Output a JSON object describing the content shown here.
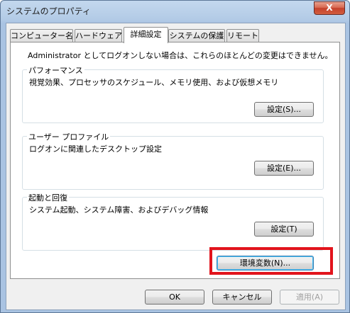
{
  "window": {
    "title": "システムのプロパティ",
    "close_label": "X"
  },
  "tabs": [
    {
      "label": "コンピューター名"
    },
    {
      "label": "ハードウェア"
    },
    {
      "label": "詳細設定"
    },
    {
      "label": "システムの保護"
    },
    {
      "label": "リモート"
    }
  ],
  "active_tab": "詳細設定",
  "panel": {
    "note": "Administrator としてログオンしない場合は、これらのほとんどの変更はできません。",
    "performance": {
      "title": "パフォーマンス",
      "description": "視覚効果、プロセッサのスケジュール、メモリ使用、および仮想メモリ",
      "button": "設定(S)..."
    },
    "user_profile": {
      "title": "ユーザー プロファイル",
      "description": "ログオンに関連したデスクトップ設定",
      "button": "設定(E)..."
    },
    "startup": {
      "title": "起動と回復",
      "description": "システム起動、システム障害、およびデバッグ情報",
      "button": "設定(T)"
    },
    "env_button": "環境変数(N)..."
  },
  "footer": {
    "ok": "OK",
    "cancel": "キャンセル",
    "apply": "適用(A)"
  },
  "colors": {
    "highlight": "#e2141c",
    "close_button": "#c4422c"
  }
}
